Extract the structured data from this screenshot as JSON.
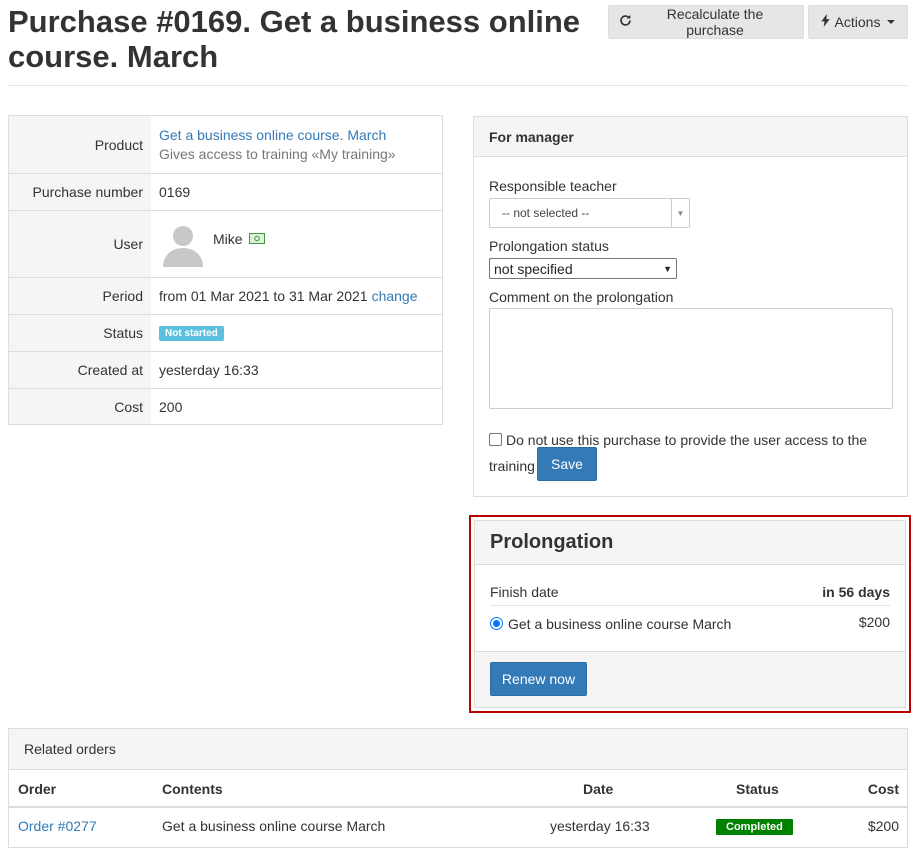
{
  "header": {
    "title": "Purchase #0169. Get a business online course. March",
    "recalc_label": "Recalculate the purchase",
    "actions_label": "Actions"
  },
  "info": {
    "product_label": "Product",
    "product_name": "Get a business online course. March",
    "product_desc": "Gives access to training «My training»",
    "number_label": "Purchase number",
    "number_value": "0169",
    "user_label": "User",
    "user_name": "Mike",
    "period_label": "Period",
    "period_text": "from 01 Mar 2021 to 31 Mar 2021",
    "period_change": "change",
    "status_label": "Status",
    "status_value": "Not started",
    "created_label": "Created at",
    "created_value": "yesterday 16:33",
    "cost_label": "Cost",
    "cost_value": "200"
  },
  "manager": {
    "title": "For manager",
    "teacher_label": "Responsible teacher",
    "teacher_value": "-- not selected --",
    "prolong_status_label": "Prolongation status",
    "prolong_status_value": "not specified",
    "comment_label": "Comment on the prolongation",
    "comment_value": "",
    "checkbox_label": "Do not use this purchase to provide the user access to the training",
    "save_label": "Save"
  },
  "prolongation": {
    "title": "Prolongation",
    "finish_label": "Finish date",
    "finish_value": "in 56 days",
    "option_label": "Get a business online course March",
    "option_price": "$200",
    "renew_label": "Renew now"
  },
  "related": {
    "title": "Related orders",
    "columns": [
      "Order",
      "Contents",
      "Date",
      "Status",
      "Cost"
    ],
    "rows": [
      {
        "order": "Order #0277",
        "contents": "Get a business online course March",
        "date": "yesterday 16:33",
        "status": "Completed",
        "cost": "$200"
      }
    ]
  },
  "colors": {
    "primary": "#337ab7",
    "highlight_border": "#bb0000",
    "status_info": "#5bc0de",
    "status_success": "#008000"
  },
  "icons": [
    "refresh-icon",
    "bolt-icon",
    "caret-down-icon",
    "user-avatar",
    "email-icon",
    "dropdown-arrow-icon"
  ]
}
